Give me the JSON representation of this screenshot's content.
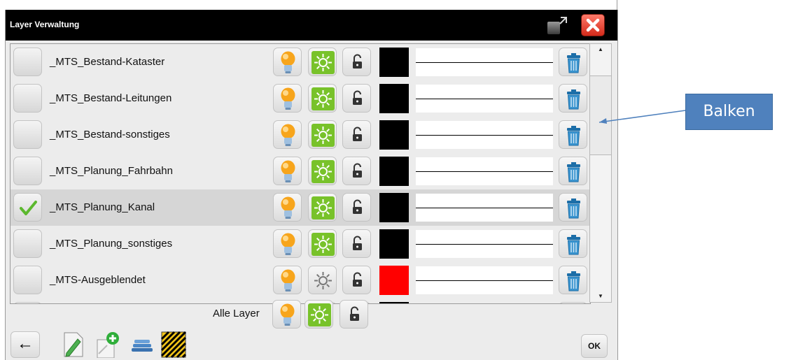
{
  "window": {
    "title": "Layer Verwaltung"
  },
  "layers": [
    {
      "name": "_MTS_Bestand-Kataster",
      "checked": false,
      "visible": true,
      "active": true,
      "locked": false,
      "color": "#000000"
    },
    {
      "name": "_MTS_Bestand-Leitungen",
      "checked": false,
      "visible": true,
      "active": true,
      "locked": false,
      "color": "#000000"
    },
    {
      "name": "_MTS_Bestand-sonstiges",
      "checked": false,
      "visible": true,
      "active": true,
      "locked": false,
      "color": "#000000"
    },
    {
      "name": "_MTS_Planung_Fahrbahn",
      "checked": false,
      "visible": true,
      "active": true,
      "locked": false,
      "color": "#000000"
    },
    {
      "name": "_MTS_Planung_Kanal",
      "checked": true,
      "visible": true,
      "active": true,
      "locked": false,
      "color": "#000000"
    },
    {
      "name": "_MTS_Planung_sonstiges",
      "checked": false,
      "visible": true,
      "active": true,
      "locked": false,
      "color": "#000000"
    },
    {
      "name": "_MTS-Ausgeblendet",
      "checked": false,
      "visible": true,
      "active": false,
      "locked": false,
      "color": "#ff0000"
    }
  ],
  "all_layers": {
    "label": "Alle Layer"
  },
  "footer": {
    "back_glyph": "←",
    "ok_label": "OK"
  },
  "annotation": {
    "label": "Balken"
  },
  "icons": {
    "visible": "lightbulb-icon",
    "active": "sun-icon",
    "lock": "unlocked-padlock-icon",
    "delete": "trash-icon",
    "check": "checkmark-icon"
  },
  "colors": {
    "active_green": "#78c22a",
    "bulb_orange": "#f7a51c",
    "trash_blue": "#2a7fb8",
    "callout_blue": "#4f81bd"
  }
}
